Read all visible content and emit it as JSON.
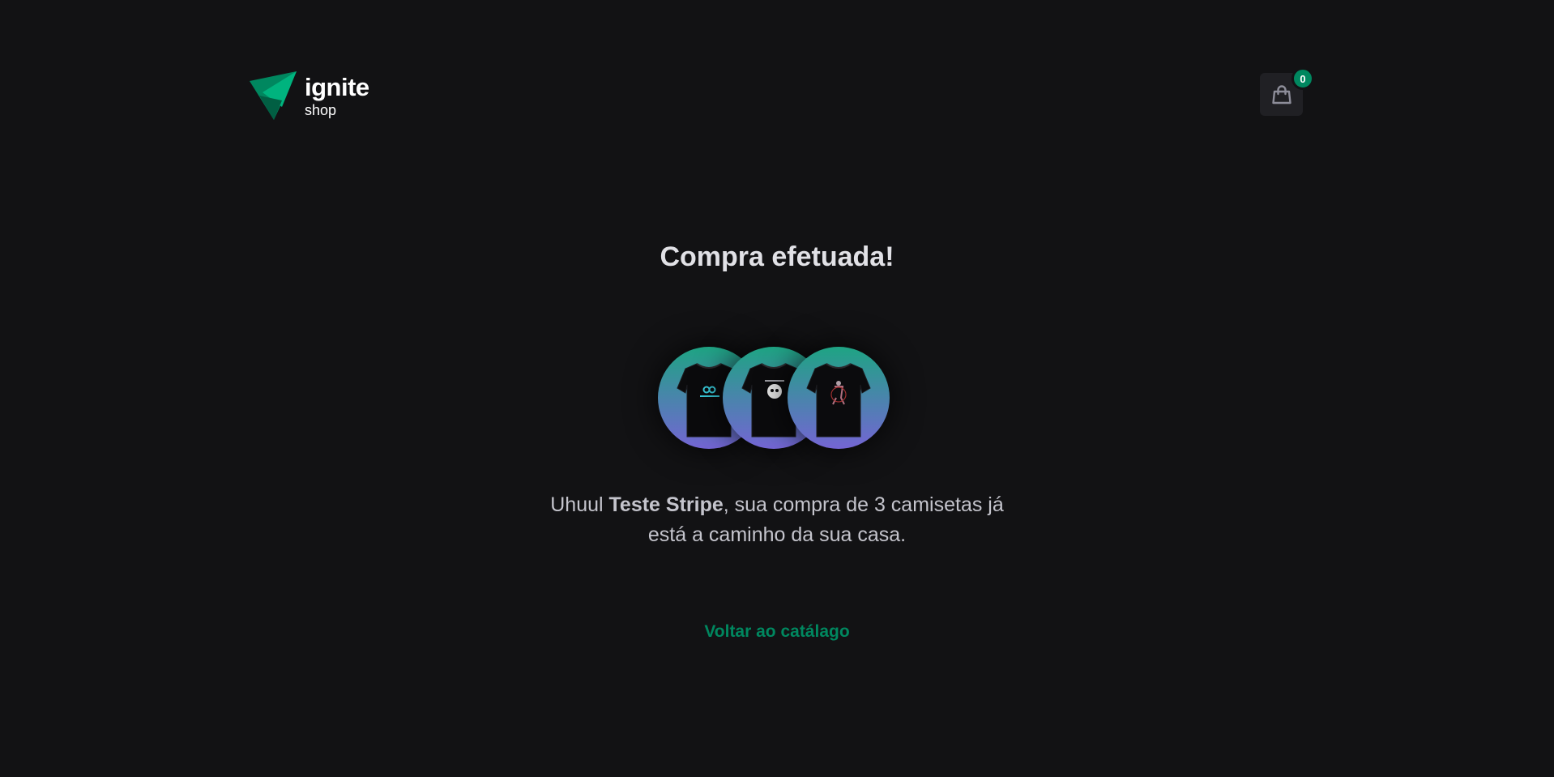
{
  "header": {
    "logo_title": "ignite",
    "logo_subtitle": "shop",
    "cart_icon": "shopping-bag-icon",
    "cart_count": "0"
  },
  "colors": {
    "background": "#121214",
    "accent": "#00875f",
    "gradient_start": "#1ea483",
    "gradient_end": "#7465d4"
  },
  "main": {
    "title": "Compra efetuada!",
    "products": [
      {
        "icon": "tshirt-icon"
      },
      {
        "icon": "tshirt-icon"
      },
      {
        "icon": "tshirt-icon"
      }
    ],
    "message_prefix": "Uhuul ",
    "customer_name": "Teste Stripe",
    "message_suffix": ", sua compra de 3 camisetas já",
    "message_line2": "está a caminho da sua casa.",
    "back_link": "Voltar ao catálago"
  }
}
